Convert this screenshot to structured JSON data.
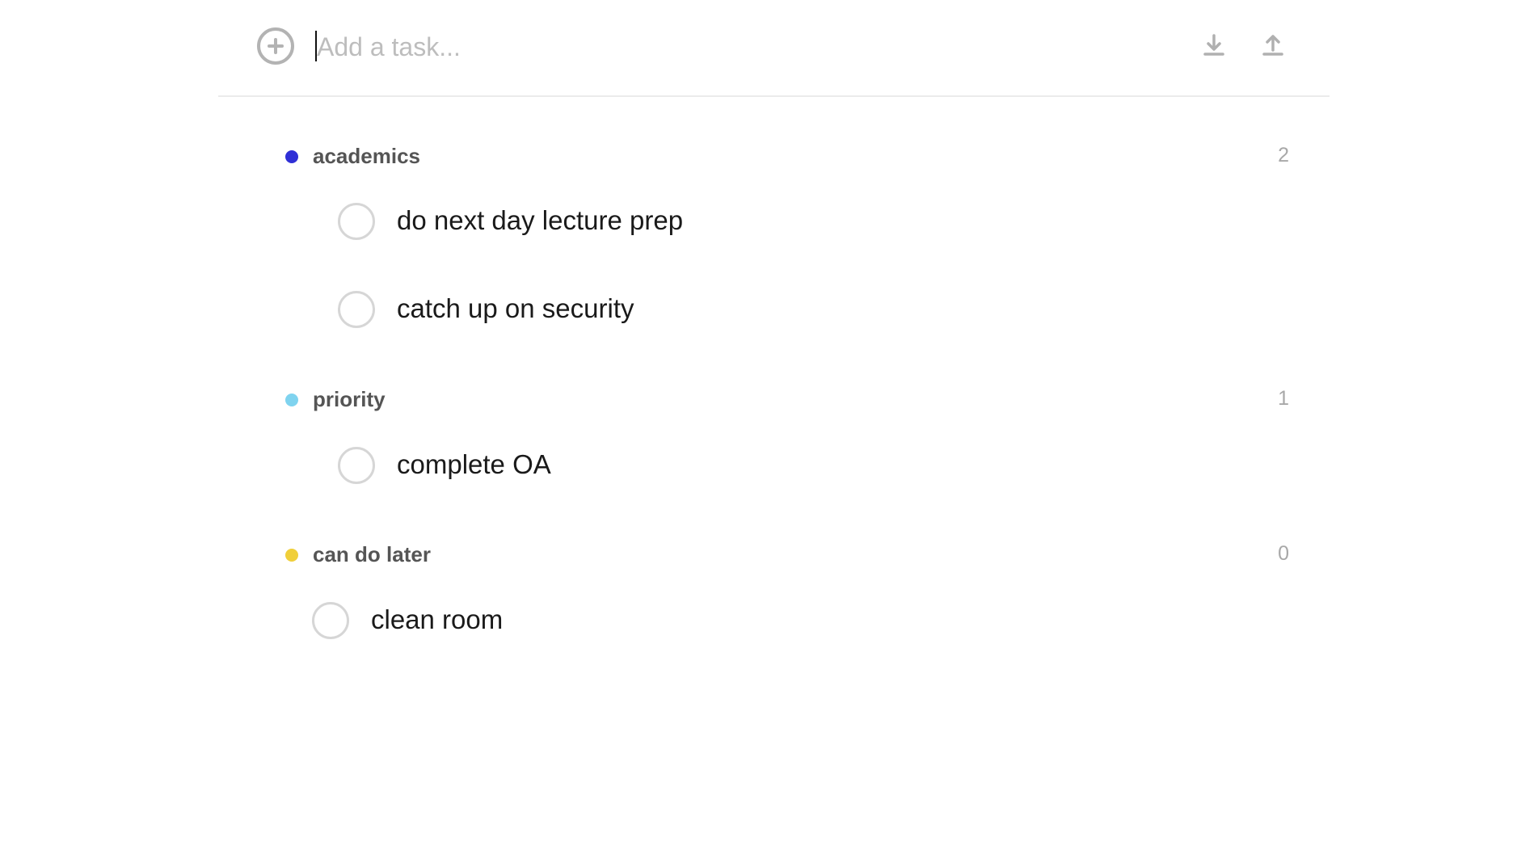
{
  "input": {
    "placeholder": "Add a task..."
  },
  "toolbar": {
    "add_icon": "plus-circle-icon",
    "download_icon": "download-icon",
    "upload_icon": "upload-icon"
  },
  "groups": [
    {
      "title": "academics",
      "count": "2",
      "color": "#2f2fd6",
      "tasks": [
        {
          "label": "do next day lecture prep"
        },
        {
          "label": "catch up on security"
        }
      ]
    },
    {
      "title": "priority",
      "count": "1",
      "color": "#7fd3ef",
      "tasks": [
        {
          "label": "complete OA"
        }
      ]
    },
    {
      "title": "can do later",
      "count": "0",
      "color": "#f0cf3a",
      "tasks": [
        {
          "label": "clean room"
        }
      ]
    }
  ]
}
